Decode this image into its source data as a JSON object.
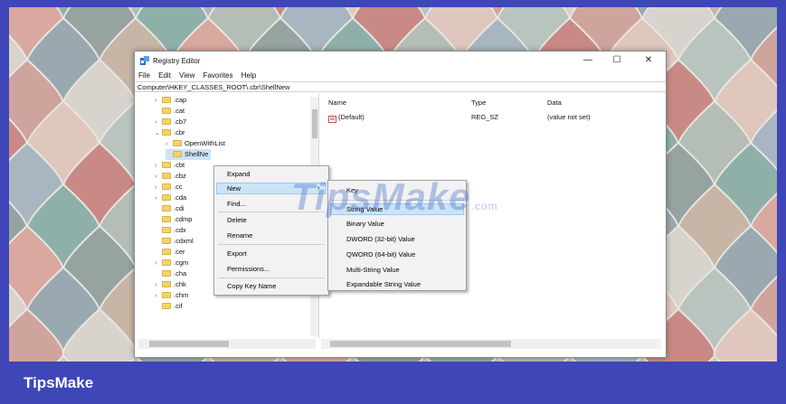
{
  "window": {
    "title": "Registry Editor",
    "controls": {
      "minimize": "—",
      "maximize": "☐",
      "close": "✕"
    }
  },
  "menu": [
    "File",
    "Edit",
    "View",
    "Favorites",
    "Help"
  ],
  "address": "Computer\\HKEY_CLASSES_ROOT\\.cbr\\ShellNew",
  "tree": [
    {
      "label": ".cap",
      "chevron": "›"
    },
    {
      "label": ".cat",
      "chevron": ""
    },
    {
      "label": ".cb7",
      "chevron": "›"
    },
    {
      "label": ".cbr",
      "chevron": "⌄"
    },
    {
      "label": "OpenWithList",
      "chevron": "›"
    },
    {
      "label": "ShellNe",
      "chevron": ""
    },
    {
      "label": ".cbt",
      "chevron": "›"
    },
    {
      "label": ".cbz",
      "chevron": "›"
    },
    {
      "label": ".cc",
      "chevron": "›"
    },
    {
      "label": ".cda",
      "chevron": "›"
    },
    {
      "label": ".cdi",
      "chevron": ""
    },
    {
      "label": ".cdmp",
      "chevron": ""
    },
    {
      "label": ".cdx",
      "chevron": ""
    },
    {
      "label": ".cdxml",
      "chevron": ""
    },
    {
      "label": ".cer",
      "chevron": ""
    },
    {
      "label": ".cgm",
      "chevron": "›"
    },
    {
      "label": ".cha",
      "chevron": ""
    },
    {
      "label": ".chk",
      "chevron": "›"
    },
    {
      "label": ".chm",
      "chevron": "›"
    },
    {
      "label": ".cif",
      "chevron": ""
    }
  ],
  "columns": {
    "name": "Name",
    "type": "Type",
    "data": "Data"
  },
  "values": [
    {
      "name": "(Default)",
      "type": "REG_SZ",
      "data": "(value not set)"
    }
  ],
  "context_menu": [
    "Expand",
    "New",
    "Find...",
    "Delete",
    "Rename",
    "Export",
    "Permissions...",
    "Copy Key Name"
  ],
  "submenu": [
    "Key",
    "String Value",
    "Binary Value",
    "DWORD (32-bit) Value",
    "QWORD (64-bit) Value",
    "Multi-String Value",
    "Expandable String Value"
  ],
  "watermark": {
    "main": "TipsMake",
    "suffix": ".com"
  },
  "footer": {
    "brand": "TipsMake"
  },
  "colors": {
    "footer": "#3f46b8",
    "selection": "#cce4f7",
    "folder": "#f2d46a"
  }
}
